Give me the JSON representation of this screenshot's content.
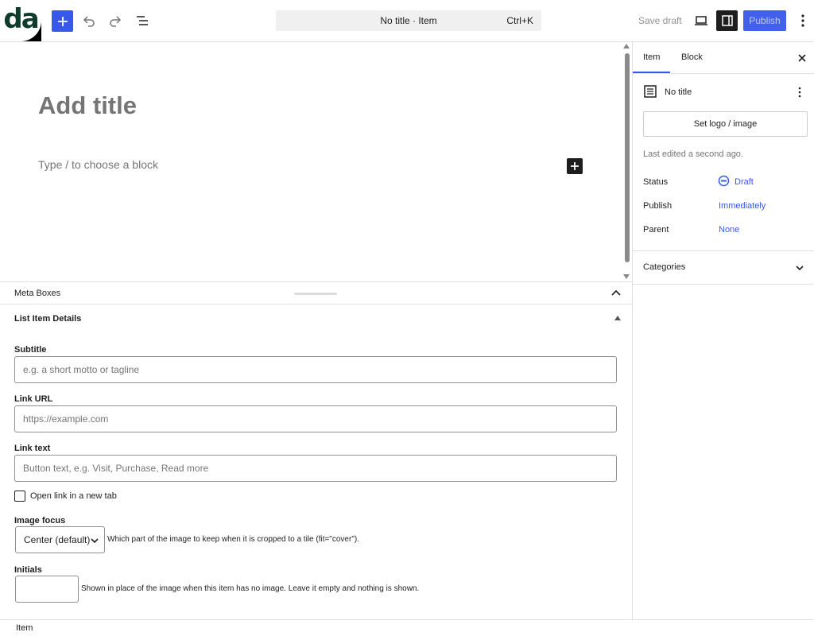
{
  "header": {
    "logo_text": "da",
    "doc_title": "No title · Item",
    "shortcut": "Ctrl+K",
    "save_draft_label": "Save draft",
    "publish_label": "Publish"
  },
  "canvas": {
    "title_placeholder": "Add title",
    "block_placeholder": "Type / to choose a block"
  },
  "meta_boxes": {
    "header_label": "Meta Boxes",
    "panel_title": "List Item Details",
    "fields": {
      "subtitle_label": "Subtitle",
      "subtitle_placeholder": "e.g. a short motto or tagline",
      "link_url_label": "Link URL",
      "link_url_placeholder": "https://example.com",
      "link_text_label": "Link text",
      "link_text_placeholder": "Button text, e.g. Visit, Purchase, Read more",
      "new_tab_label": "Open link in a new tab",
      "image_focus_label": "Image focus",
      "image_focus_value": "Center (default)",
      "image_focus_help": "Which part of the image to keep when it is cropped to a tile (fit=\"cover\").",
      "initials_label": "Initials",
      "initials_help": "Shown in place of the image when this item has no image. Leave it empty and nothing is shown."
    }
  },
  "footer": {
    "breadcrumb": "Item"
  },
  "sidebar": {
    "tabs": [
      {
        "label": "Item",
        "active": true
      },
      {
        "label": "Block",
        "active": false
      }
    ],
    "doc_title": "No title",
    "logo_button_label": "Set logo / image",
    "last_edited": "Last edited a second ago.",
    "rows": [
      {
        "label": "Status",
        "value": "Draft"
      },
      {
        "label": "Publish",
        "value": "Immediately"
      },
      {
        "label": "Parent",
        "value": "None"
      }
    ],
    "categories_label": "Categories"
  },
  "colors": {
    "accent": "#3858e9",
    "dark": "#1e1e1e",
    "muted": "#757575",
    "border": "#e0e0e0"
  }
}
